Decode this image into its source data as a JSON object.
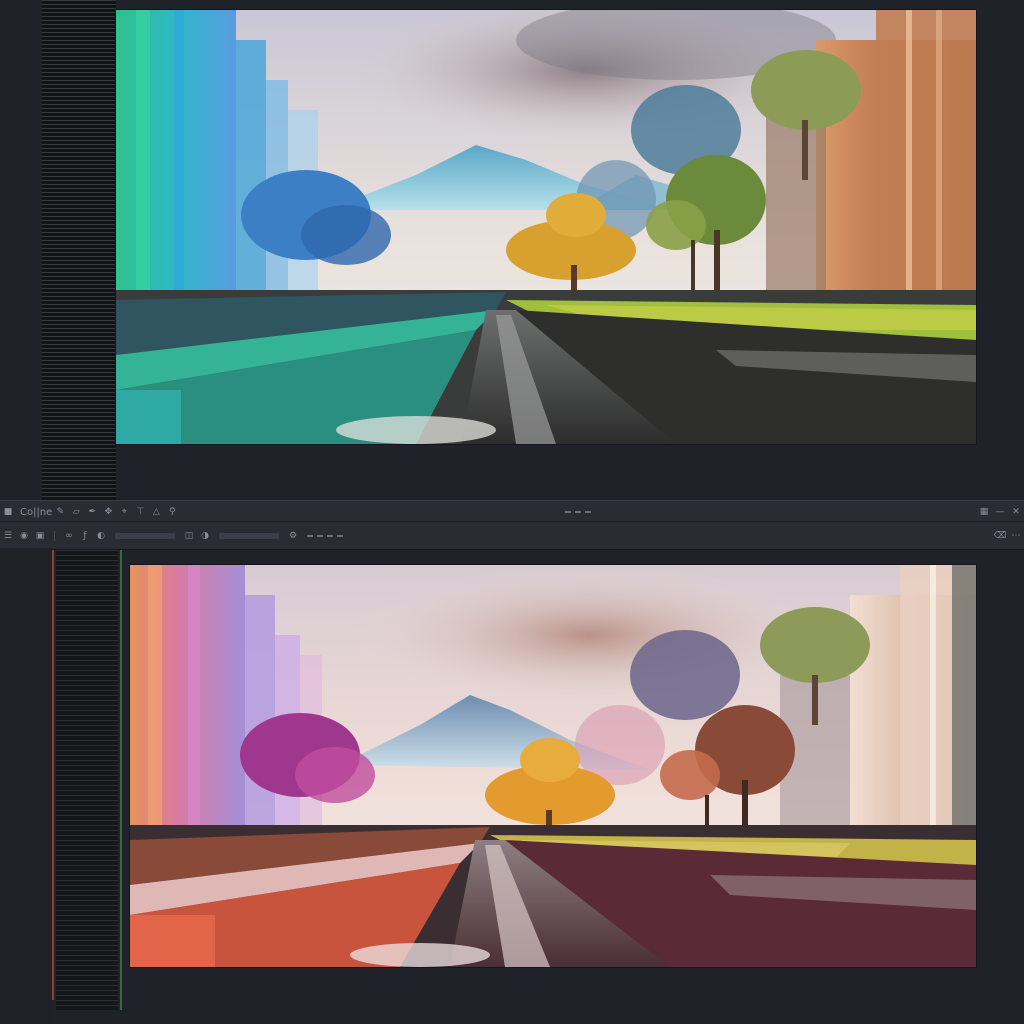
{
  "app": {
    "title": "Co||ne",
    "accent_left": "#c9473c",
    "accent_mid": "#3f9f5a"
  },
  "toolbar": {
    "row1_icons": [
      "brush-icon",
      "eraser-icon",
      "pen-icon",
      "move-icon",
      "crop-icon",
      "text-icon",
      "shape-icon",
      "zoom-icon"
    ],
    "row2_icons": [
      "layers-icon",
      "eye-icon",
      "lock-icon",
      "link-icon",
      "fx-icon",
      "mask-icon",
      "folder-icon",
      "adjust-icon",
      "trash-icon"
    ]
  },
  "canvases": {
    "top": {
      "palette": "teal-cyan"
    },
    "bottom": {
      "palette": "rose-magenta"
    }
  }
}
